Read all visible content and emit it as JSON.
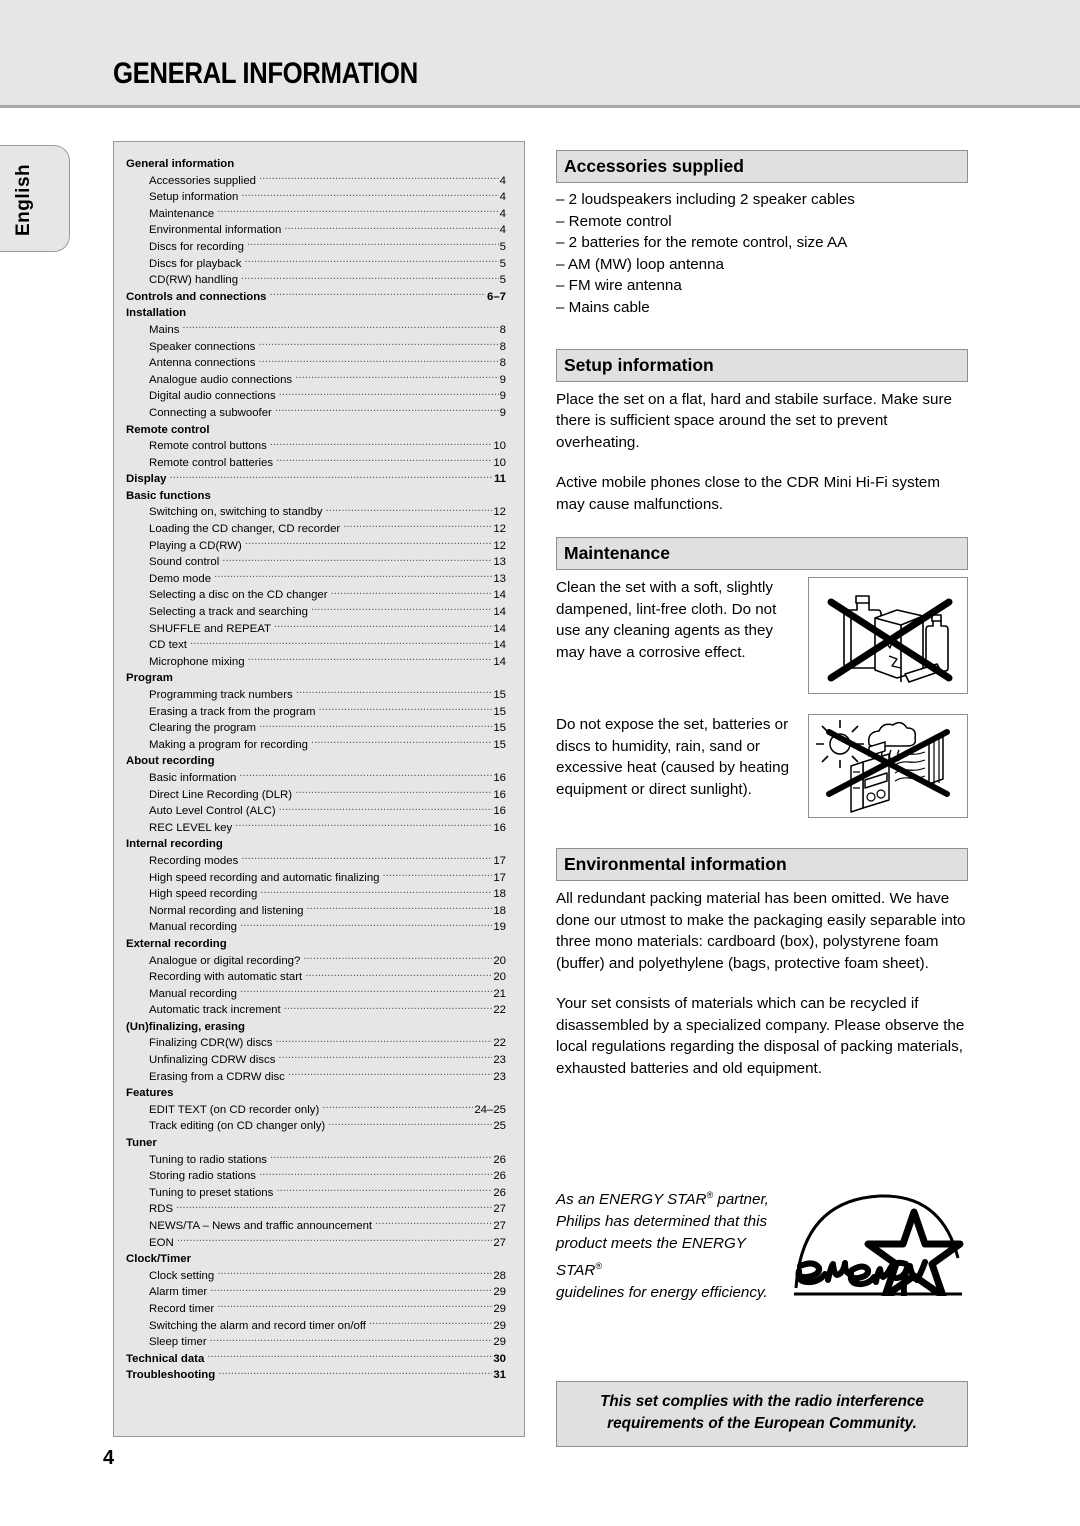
{
  "header": {
    "title": "GENERAL INFORMATION"
  },
  "side_tab": {
    "label": "English"
  },
  "page_number": "4",
  "toc": {
    "groups": [
      {
        "title": "General information",
        "page": "",
        "items": [
          {
            "label": "Accessories supplied",
            "page": "4"
          },
          {
            "label": "Setup information",
            "page": "4"
          },
          {
            "label": "Maintenance",
            "page": "4"
          },
          {
            "label": "Environmental information",
            "page": "4"
          },
          {
            "label": "Discs for recording",
            "page": "5"
          },
          {
            "label": "Discs for playback",
            "page": "5"
          },
          {
            "label": "CD(RW) handling",
            "page": "5"
          }
        ]
      },
      {
        "title": "Controls and connections",
        "page": "6–7",
        "items": []
      },
      {
        "title": "Installation",
        "page": "",
        "items": [
          {
            "label": "Mains",
            "page": "8"
          },
          {
            "label": "Speaker connections",
            "page": "8"
          },
          {
            "label": "Antenna connections",
            "page": "8"
          },
          {
            "label": "Analogue audio connections",
            "page": "9"
          },
          {
            "label": "Digital audio connections",
            "page": "9"
          },
          {
            "label": "Connecting a subwoofer",
            "page": "9"
          }
        ]
      },
      {
        "title": "Remote control",
        "page": "",
        "items": [
          {
            "label": "Remote control buttons",
            "page": "10"
          },
          {
            "label": "Remote control batteries",
            "page": "10"
          }
        ]
      },
      {
        "title": "Display",
        "page": "11",
        "items": []
      },
      {
        "title": "Basic functions",
        "page": "",
        "items": [
          {
            "label": "Switching on, switching to standby",
            "page": "12"
          },
          {
            "label": "Loading the CD changer, CD recorder",
            "page": "12"
          },
          {
            "label": "Playing a CD(RW)",
            "page": "12"
          },
          {
            "label": "Sound control",
            "page": "13"
          },
          {
            "label": "Demo mode",
            "page": "13"
          },
          {
            "label": "Selecting a disc on the CD changer",
            "page": "14"
          },
          {
            "label": "Selecting a track and searching",
            "page": "14"
          },
          {
            "label": "SHUFFLE and REPEAT",
            "page": "14"
          },
          {
            "label": "CD text",
            "page": "14"
          },
          {
            "label": "Microphone mixing",
            "page": "14"
          }
        ]
      },
      {
        "title": "Program",
        "page": "",
        "items": [
          {
            "label": "Programming track numbers",
            "page": "15"
          },
          {
            "label": "Erasing a track from the program",
            "page": "15"
          },
          {
            "label": "Clearing the program",
            "page": "15"
          },
          {
            "label": "Making a program for recording",
            "page": "15"
          }
        ]
      },
      {
        "title": "About recording",
        "page": "",
        "items": [
          {
            "label": "Basic information",
            "page": "16"
          },
          {
            "label": "Direct Line Recording (DLR)",
            "page": "16"
          },
          {
            "label": "Auto Level Control (ALC)",
            "page": "16"
          },
          {
            "label": "REC LEVEL key",
            "page": "16"
          }
        ]
      },
      {
        "title": "Internal recording",
        "page": "",
        "items": [
          {
            "label": "Recording modes",
            "page": "17"
          },
          {
            "label": "High speed recording and automatic finalizing",
            "page": "17"
          },
          {
            "label": "High speed recording",
            "page": "18"
          },
          {
            "label": "Normal recording and listening",
            "page": "18"
          },
          {
            "label": "Manual recording",
            "page": "19"
          }
        ]
      },
      {
        "title": "External recording",
        "page": "",
        "items": [
          {
            "label": "Analogue or digital recording?",
            "page": "20"
          },
          {
            "label": "Recording with automatic start",
            "page": "20"
          },
          {
            "label": "Manual recording",
            "page": "21"
          },
          {
            "label": "Automatic track increment",
            "page": "22"
          }
        ]
      },
      {
        "title": "(Un)finalizing, erasing",
        "page": "",
        "items": [
          {
            "label": "Finalizing CDR(W) discs",
            "page": "22"
          },
          {
            "label": "Unfinalizing CDRW discs",
            "page": "23"
          },
          {
            "label": "Erasing from a CDRW disc",
            "page": "23"
          }
        ]
      },
      {
        "title": "Features",
        "page": "",
        "items": [
          {
            "label": "EDIT TEXT (on CD recorder only)",
            "page": "24–25"
          },
          {
            "label": "Track editing (on CD changer only)",
            "page": "25"
          }
        ]
      },
      {
        "title": "Tuner",
        "page": "",
        "items": [
          {
            "label": "Tuning to radio stations",
            "page": "26"
          },
          {
            "label": "Storing radio stations",
            "page": "26"
          },
          {
            "label": "Tuning to preset stations",
            "page": "26"
          },
          {
            "label": "RDS",
            "page": "27"
          },
          {
            "label": "NEWS/TA – News and traffic announcement",
            "page": "27"
          },
          {
            "label": "EON",
            "page": "27"
          }
        ]
      },
      {
        "title": "Clock/Timer",
        "page": "",
        "items": [
          {
            "label": "Clock setting",
            "page": "28"
          },
          {
            "label": "Alarm timer",
            "page": "29"
          },
          {
            "label": "Record timer",
            "page": "29"
          },
          {
            "label": "Switching the alarm and record timer on/off",
            "page": "29"
          },
          {
            "label": "Sleep timer",
            "page": "29"
          }
        ]
      },
      {
        "title": "Technical data",
        "page": "30",
        "items": []
      },
      {
        "title": "Troubleshooting",
        "page": "31",
        "items": []
      }
    ]
  },
  "accessories": {
    "heading": "Accessories supplied",
    "items": [
      "– 2 loudspeakers including 2 speaker cables",
      "– Remote control",
      "– 2 batteries for the remote control, size AA",
      "– AM (MW) loop antenna",
      "– FM wire antenna",
      "– Mains cable"
    ]
  },
  "setup": {
    "heading": "Setup information",
    "paragraph1": "Place the set on a flat, hard and stabile surface. Make sure there is sufficient space around the set to prevent overheating.",
    "paragraph2": "Active mobile phones close to the CDR Mini Hi-Fi system may cause malfunctions."
  },
  "maintenance": {
    "heading": "Maintenance",
    "paragraph1": "Clean the set with a soft, slightly dampened, lint-free cloth. Do not use any cleaning agents as they may have a corrosive effect.",
    "paragraph2": "Do not expose the set, batteries or discs to humidity, rain, sand or excessive heat (caused by heating equipment or direct sunlight)."
  },
  "environmental": {
    "heading": "Environmental information",
    "paragraph1": "All redundant packing material has been omitted. We have done our utmost to make the packaging easily separable into three mono materials: cardboard (box), polystyrene foam (buffer) and polyethylene (bags, protective foam sheet).",
    "paragraph2": "Your set consists of materials which can be recycled if disassembled by a specialized company. Please observe the local regulations regarding the disposal of packing materials, exhausted batteries and old equipment."
  },
  "energy_star": {
    "line1": "As an ENERGY STAR",
    "line1b": " partner,",
    "line2": "Philips has determined that this",
    "line3": "product meets the ENERGY STAR",
    "line4": "guidelines for energy efficiency.",
    "logo_text": "energy"
  },
  "compliance": {
    "line1": "This set complies with the radio interference",
    "line2": "requirements of the European Community."
  },
  "colors": {
    "header_band": "#e6e6e6",
    "panel_bg": "#e6e6e6",
    "heading_bg": "#e0e0e0",
    "border": "#8f8f8f"
  }
}
